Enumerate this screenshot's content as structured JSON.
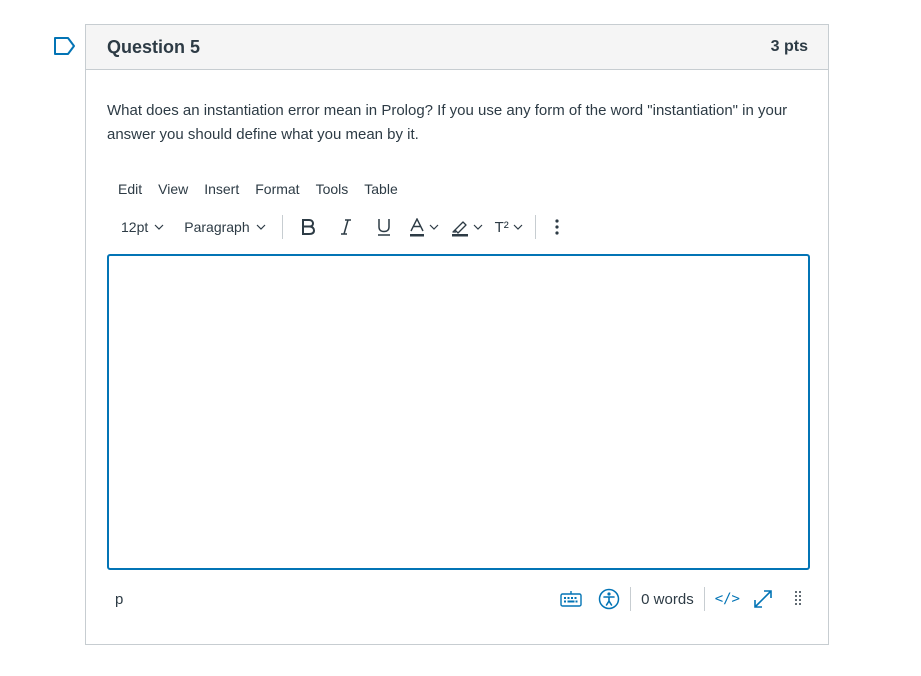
{
  "question": {
    "title": "Question 5",
    "points": "3 pts",
    "text": "What does an instantiation error mean in Prolog?  If you use any form of the word \"instantiation\" in your answer you should define what you mean by it."
  },
  "editor": {
    "menu": [
      "Edit",
      "View",
      "Insert",
      "Format",
      "Tools",
      "Table"
    ],
    "font_size": "12pt",
    "block_format": "Paragraph",
    "superscript_label": "T²",
    "path": "p",
    "word_count": "0 words",
    "html_label": "</>",
    "content": ""
  },
  "colors": {
    "accent": "#0374b5",
    "text": "#2d3b45",
    "border": "#c7cdd1",
    "header_bg": "#f5f5f5"
  },
  "icons": [
    "flag-icon",
    "bold-icon",
    "italic-icon",
    "underline-icon",
    "text-color-icon",
    "highlight-icon",
    "superscript-icon",
    "more-icon",
    "keyboard-icon",
    "accessibility-icon",
    "fullscreen-icon",
    "resize-handle-icon"
  ]
}
